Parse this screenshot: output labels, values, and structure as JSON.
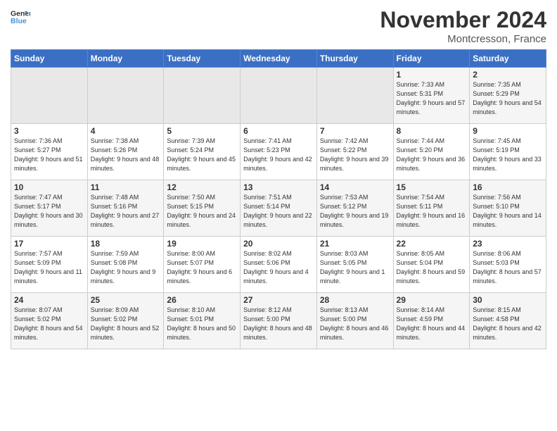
{
  "header": {
    "logo_line1": "General",
    "logo_line2": "Blue",
    "month_title": "November 2024",
    "location": "Montcresson, France"
  },
  "weekdays": [
    "Sunday",
    "Monday",
    "Tuesday",
    "Wednesday",
    "Thursday",
    "Friday",
    "Saturday"
  ],
  "weeks": [
    [
      {
        "day": "",
        "empty": true
      },
      {
        "day": "",
        "empty": true
      },
      {
        "day": "",
        "empty": true
      },
      {
        "day": "",
        "empty": true
      },
      {
        "day": "",
        "empty": true
      },
      {
        "day": "1",
        "sunrise": "Sunrise: 7:33 AM",
        "sunset": "Sunset: 5:31 PM",
        "daylight": "Daylight: 9 hours and 57 minutes."
      },
      {
        "day": "2",
        "sunrise": "Sunrise: 7:35 AM",
        "sunset": "Sunset: 5:29 PM",
        "daylight": "Daylight: 9 hours and 54 minutes."
      }
    ],
    [
      {
        "day": "3",
        "sunrise": "Sunrise: 7:36 AM",
        "sunset": "Sunset: 5:27 PM",
        "daylight": "Daylight: 9 hours and 51 minutes."
      },
      {
        "day": "4",
        "sunrise": "Sunrise: 7:38 AM",
        "sunset": "Sunset: 5:26 PM",
        "daylight": "Daylight: 9 hours and 48 minutes."
      },
      {
        "day": "5",
        "sunrise": "Sunrise: 7:39 AM",
        "sunset": "Sunset: 5:24 PM",
        "daylight": "Daylight: 9 hours and 45 minutes."
      },
      {
        "day": "6",
        "sunrise": "Sunrise: 7:41 AM",
        "sunset": "Sunset: 5:23 PM",
        "daylight": "Daylight: 9 hours and 42 minutes."
      },
      {
        "day": "7",
        "sunrise": "Sunrise: 7:42 AM",
        "sunset": "Sunset: 5:22 PM",
        "daylight": "Daylight: 9 hours and 39 minutes."
      },
      {
        "day": "8",
        "sunrise": "Sunrise: 7:44 AM",
        "sunset": "Sunset: 5:20 PM",
        "daylight": "Daylight: 9 hours and 36 minutes."
      },
      {
        "day": "9",
        "sunrise": "Sunrise: 7:45 AM",
        "sunset": "Sunset: 5:19 PM",
        "daylight": "Daylight: 9 hours and 33 minutes."
      }
    ],
    [
      {
        "day": "10",
        "sunrise": "Sunrise: 7:47 AM",
        "sunset": "Sunset: 5:17 PM",
        "daylight": "Daylight: 9 hours and 30 minutes."
      },
      {
        "day": "11",
        "sunrise": "Sunrise: 7:48 AM",
        "sunset": "Sunset: 5:16 PM",
        "daylight": "Daylight: 9 hours and 27 minutes."
      },
      {
        "day": "12",
        "sunrise": "Sunrise: 7:50 AM",
        "sunset": "Sunset: 5:15 PM",
        "daylight": "Daylight: 9 hours and 24 minutes."
      },
      {
        "day": "13",
        "sunrise": "Sunrise: 7:51 AM",
        "sunset": "Sunset: 5:14 PM",
        "daylight": "Daylight: 9 hours and 22 minutes."
      },
      {
        "day": "14",
        "sunrise": "Sunrise: 7:53 AM",
        "sunset": "Sunset: 5:12 PM",
        "daylight": "Daylight: 9 hours and 19 minutes."
      },
      {
        "day": "15",
        "sunrise": "Sunrise: 7:54 AM",
        "sunset": "Sunset: 5:11 PM",
        "daylight": "Daylight: 9 hours and 16 minutes."
      },
      {
        "day": "16",
        "sunrise": "Sunrise: 7:56 AM",
        "sunset": "Sunset: 5:10 PM",
        "daylight": "Daylight: 9 hours and 14 minutes."
      }
    ],
    [
      {
        "day": "17",
        "sunrise": "Sunrise: 7:57 AM",
        "sunset": "Sunset: 5:09 PM",
        "daylight": "Daylight: 9 hours and 11 minutes."
      },
      {
        "day": "18",
        "sunrise": "Sunrise: 7:59 AM",
        "sunset": "Sunset: 5:08 PM",
        "daylight": "Daylight: 9 hours and 9 minutes."
      },
      {
        "day": "19",
        "sunrise": "Sunrise: 8:00 AM",
        "sunset": "Sunset: 5:07 PM",
        "daylight": "Daylight: 9 hours and 6 minutes."
      },
      {
        "day": "20",
        "sunrise": "Sunrise: 8:02 AM",
        "sunset": "Sunset: 5:06 PM",
        "daylight": "Daylight: 9 hours and 4 minutes."
      },
      {
        "day": "21",
        "sunrise": "Sunrise: 8:03 AM",
        "sunset": "Sunset: 5:05 PM",
        "daylight": "Daylight: 9 hours and 1 minute."
      },
      {
        "day": "22",
        "sunrise": "Sunrise: 8:05 AM",
        "sunset": "Sunset: 5:04 PM",
        "daylight": "Daylight: 8 hours and 59 minutes."
      },
      {
        "day": "23",
        "sunrise": "Sunrise: 8:06 AM",
        "sunset": "Sunset: 5:03 PM",
        "daylight": "Daylight: 8 hours and 57 minutes."
      }
    ],
    [
      {
        "day": "24",
        "sunrise": "Sunrise: 8:07 AM",
        "sunset": "Sunset: 5:02 PM",
        "daylight": "Daylight: 8 hours and 54 minutes."
      },
      {
        "day": "25",
        "sunrise": "Sunrise: 8:09 AM",
        "sunset": "Sunset: 5:02 PM",
        "daylight": "Daylight: 8 hours and 52 minutes."
      },
      {
        "day": "26",
        "sunrise": "Sunrise: 8:10 AM",
        "sunset": "Sunset: 5:01 PM",
        "daylight": "Daylight: 8 hours and 50 minutes."
      },
      {
        "day": "27",
        "sunrise": "Sunrise: 8:12 AM",
        "sunset": "Sunset: 5:00 PM",
        "daylight": "Daylight: 8 hours and 48 minutes."
      },
      {
        "day": "28",
        "sunrise": "Sunrise: 8:13 AM",
        "sunset": "Sunset: 5:00 PM",
        "daylight": "Daylight: 8 hours and 46 minutes."
      },
      {
        "day": "29",
        "sunrise": "Sunrise: 8:14 AM",
        "sunset": "Sunset: 4:59 PM",
        "daylight": "Daylight: 8 hours and 44 minutes."
      },
      {
        "day": "30",
        "sunrise": "Sunrise: 8:15 AM",
        "sunset": "Sunset: 4:58 PM",
        "daylight": "Daylight: 8 hours and 42 minutes."
      }
    ]
  ]
}
